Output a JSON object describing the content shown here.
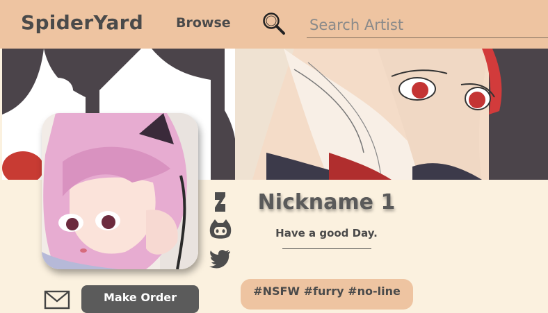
{
  "header": {
    "logo": "SpiderYard",
    "nav_browse": "Browse",
    "search": {
      "placeholder": "Search Artist",
      "value": ""
    }
  },
  "profile": {
    "nickname": "Nickname 1",
    "status": "Have a good Day.",
    "tags": "#NSFW #furry #no-line",
    "order_button": "Make Order",
    "social_links": [
      {
        "name": "deviantart-icon"
      },
      {
        "name": "github-icon"
      },
      {
        "name": "twitter-icon"
      }
    ]
  },
  "colors": {
    "header_bg": "#eec4a1",
    "page_bg": "#fbf1df",
    "button_bg": "#5b5b5b",
    "text_dark": "#4a4a4a"
  }
}
